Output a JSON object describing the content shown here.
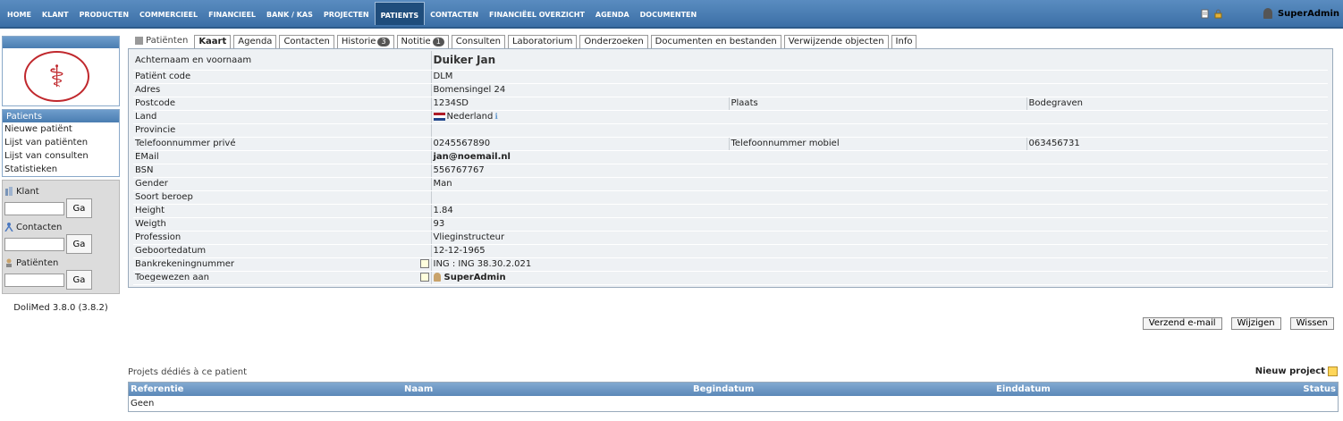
{
  "topnav": {
    "items": [
      "HOME",
      "KLANT",
      "PRODUCTEN",
      "COMMERCIEEL",
      "FINANCIEEL",
      "BANK / KAS",
      "PROJECTEN",
      "PATIENTS",
      "CONTACTEN",
      "FINANCIËEL OVERZICHT",
      "AGENDA",
      "DOCUMENTEN"
    ],
    "user": "SuperAdmin"
  },
  "sidebar": {
    "menu_title": "Patients",
    "menu_items": [
      "Nieuwe patiënt",
      "Lijst van patiënten",
      "Lijst van consulten",
      "Statistieken"
    ],
    "search": [
      {
        "label": "Klant",
        "button": "Ga"
      },
      {
        "label": "Contacten",
        "button": "Ga"
      },
      {
        "label": "Patiënten",
        "button": "Ga"
      }
    ],
    "version": "DoliMed 3.8.0 (3.8.2)"
  },
  "tabs": [
    {
      "label": "Patiënten",
      "badge": ""
    },
    {
      "label": "Kaart",
      "badge": ""
    },
    {
      "label": "Agenda",
      "badge": ""
    },
    {
      "label": "Contacten",
      "badge": ""
    },
    {
      "label": "Historie",
      "badge": "3"
    },
    {
      "label": "Notitie",
      "badge": "1"
    },
    {
      "label": "Consulten",
      "badge": ""
    },
    {
      "label": "Laboratorium",
      "badge": ""
    },
    {
      "label": "Onderzoeken",
      "badge": ""
    },
    {
      "label": "Documenten en bestanden",
      "badge": ""
    },
    {
      "label": "Verwijzende objecten",
      "badge": ""
    },
    {
      "label": "Info",
      "badge": ""
    }
  ],
  "card": {
    "name_label": "Achternaam en voornaam",
    "name_value": "Duiker Jan",
    "code_label": "Patiënt code",
    "code_value": "DLM",
    "adres_label": "Adres",
    "adres_value": "Bomensingel 24",
    "postcode_label": "Postcode",
    "postcode_value": "1234SD",
    "plaats_label": "Plaats",
    "plaats_value": "Bodegraven",
    "land_label": "Land",
    "land_value": "Nederland",
    "provincie_label": "Provincie",
    "provincie_value": "",
    "tel_label": "Telefoonnummer privé",
    "tel_value": "0245567890",
    "mob_label": "Telefoonnummer mobiel",
    "mob_value": "063456731",
    "email_label": "EMail",
    "email_value": "jan@noemail.nl",
    "bsn_label": "BSN",
    "bsn_value": "556767767",
    "gender_label": "Gender",
    "gender_value": "Man",
    "beroep_label": "Soort beroep",
    "beroep_value": "",
    "height_label": "Height",
    "height_value": "1.84",
    "weight_label": "Weigth",
    "weight_value": "93",
    "profession_label": "Profession",
    "profession_value": "Vlieginstructeur",
    "dob_label": "Geboortedatum",
    "dob_value": "12-12-1965",
    "bank_label": "Bankrekeningnummer",
    "bank_value": "ING : ING 38.30.2.021",
    "assigned_label": "Toegewezen aan",
    "assigned_value": "SuperAdmin"
  },
  "actions": [
    "Verzend e-mail",
    "Wijzigen",
    "Wissen"
  ],
  "projects": {
    "title": "Projets dédiés à ce patient",
    "new_label": "Nieuw project",
    "columns": [
      "Referentie",
      "Naam",
      "Begindatum",
      "Einddatum",
      "Status"
    ],
    "empty": "Geen"
  }
}
